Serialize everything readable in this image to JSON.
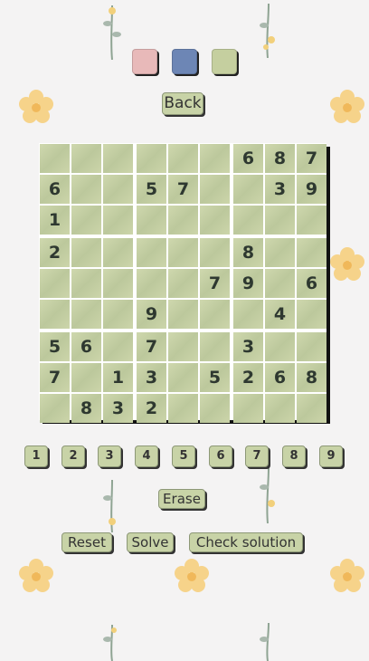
{
  "theme_swatches": [
    {
      "name": "pink-theme-swatch",
      "color": "#e8b9b9"
    },
    {
      "name": "blue-theme-swatch",
      "color": "#6d86b5"
    },
    {
      "name": "green-theme-swatch",
      "color": "#c5cf9f"
    }
  ],
  "back_label": "Back",
  "board": [
    [
      "",
      "",
      "",
      "",
      "",
      "",
      "6",
      "8",
      "7"
    ],
    [
      "6",
      "",
      "",
      "5",
      "7",
      "",
      "",
      "3",
      "9"
    ],
    [
      "1",
      "",
      "",
      "",
      "",
      "",
      "",
      "",
      ""
    ],
    [
      "2",
      "",
      "",
      "",
      "",
      "",
      "8",
      "",
      ""
    ],
    [
      "",
      "",
      "",
      "",
      "",
      "7",
      "9",
      "",
      "6"
    ],
    [
      "",
      "",
      "",
      "9",
      "",
      "",
      "",
      "4",
      ""
    ],
    [
      "5",
      "6",
      "",
      "7",
      "",
      "",
      "3",
      "",
      ""
    ],
    [
      "7",
      "",
      "1",
      "3",
      "",
      "5",
      "2",
      "6",
      "8"
    ],
    [
      "",
      "8",
      "3",
      "2",
      "",
      "",
      "",
      "",
      ""
    ]
  ],
  "numpad": [
    "1",
    "2",
    "3",
    "4",
    "5",
    "6",
    "7",
    "8",
    "9"
  ],
  "erase_label": "Erase",
  "actions": {
    "reset_label": "Reset",
    "solve_label": "Solve",
    "check_label": "Check solution"
  },
  "colors": {
    "cell": "#c9d3a8",
    "digit": "#2e3830",
    "background": "#f4f3f3"
  },
  "decorations": [
    "flower-icon",
    "plant-sprig-icon"
  ]
}
